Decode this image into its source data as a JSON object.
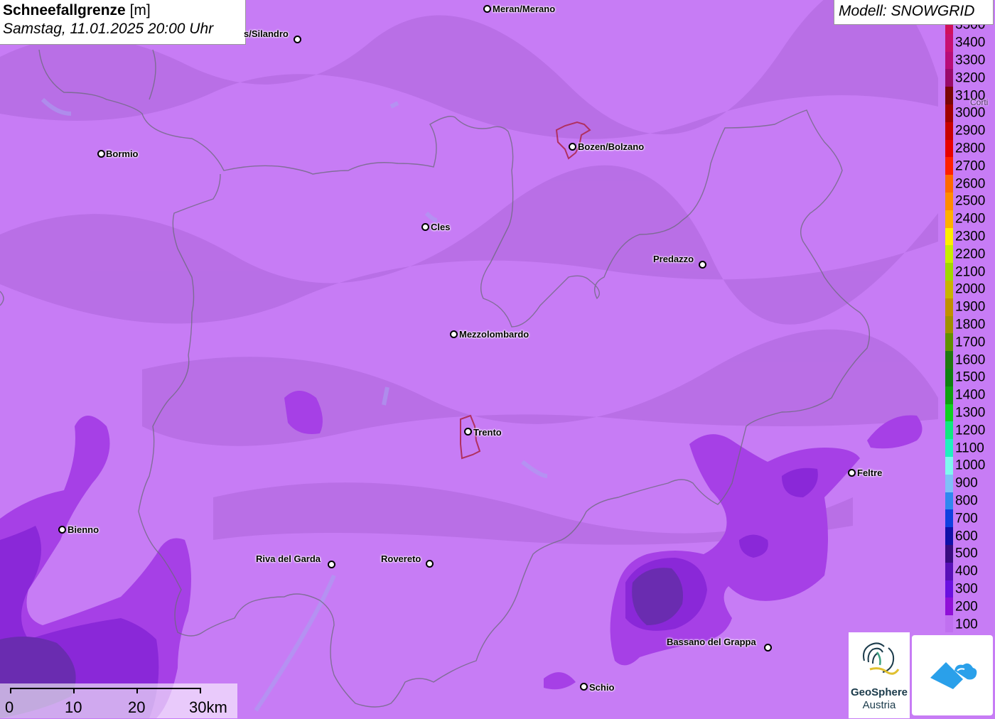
{
  "header": {
    "title_bold": "Schneefallgrenze",
    "title_unit": " [m]",
    "date": "Samstag, 11.01.2025 20:00 Uhr"
  },
  "model": {
    "label": "Modell: SNOWGRID"
  },
  "legend": {
    "items": [
      {
        "label": "3500",
        "color": "#d0105a"
      },
      {
        "label": "3400",
        "color": "#c81070"
      },
      {
        "label": "3300",
        "color": "#b80c78"
      },
      {
        "label": "3200",
        "color": "#9a0a6a"
      },
      {
        "label": "3100",
        "color": "#7a0505"
      },
      {
        "label": "3000",
        "color": "#a00000"
      },
      {
        "label": "2900",
        "color": "#c80000"
      },
      {
        "label": "2800",
        "color": "#e80000"
      },
      {
        "label": "2700",
        "color": "#ff2000"
      },
      {
        "label": "2600",
        "color": "#ff6a00"
      },
      {
        "label": "2500",
        "color": "#ff8c00"
      },
      {
        "label": "2400",
        "color": "#ffb000"
      },
      {
        "label": "2300",
        "color": "#ffee00"
      },
      {
        "label": "2200",
        "color": "#c8ee00"
      },
      {
        "label": "2100",
        "color": "#a0d800"
      },
      {
        "label": "2000",
        "color": "#c8b400"
      },
      {
        "label": "1900",
        "color": "#c09000"
      },
      {
        "label": "1800",
        "color": "#a09000"
      },
      {
        "label": "1700",
        "color": "#609000"
      },
      {
        "label": "1600",
        "color": "#207810"
      },
      {
        "label": "1500",
        "color": "#108010"
      },
      {
        "label": "1400",
        "color": "#10a010"
      },
      {
        "label": "1300",
        "color": "#10d020"
      },
      {
        "label": "1200",
        "color": "#10e880"
      },
      {
        "label": "1100",
        "color": "#20f0c0"
      },
      {
        "label": "1000",
        "color": "#80f8f0"
      },
      {
        "label": "900",
        "color": "#80c0f8"
      },
      {
        "label": "800",
        "color": "#3088f0"
      },
      {
        "label": "700",
        "color": "#1040e0"
      },
      {
        "label": "600",
        "color": "#1010a8"
      },
      {
        "label": "500",
        "color": "#380c80"
      },
      {
        "label": "400",
        "color": "#5810b8"
      },
      {
        "label": "300",
        "color": "#6a10e0"
      },
      {
        "label": "200",
        "color": "#9010d8"
      },
      {
        "label": "100",
        "color": "#c070f0"
      }
    ]
  },
  "cities": [
    {
      "name": "Meran/Merano"
    },
    {
      "name": "s/Silandro"
    },
    {
      "name": "Bormio"
    },
    {
      "name": "Bozen/Bolzano"
    },
    {
      "name": "Cles"
    },
    {
      "name": "Predazzo"
    },
    {
      "name": "Mezzolombardo"
    },
    {
      "name": "Trento"
    },
    {
      "name": "Feltre"
    },
    {
      "name": "Bienno"
    },
    {
      "name": "Riva del Garda"
    },
    {
      "name": "Rovereto"
    },
    {
      "name": "Bassano del Grappa"
    },
    {
      "name": "Schio"
    },
    {
      "name": "Corti"
    }
  ],
  "scale": {
    "labels": [
      "0",
      "10",
      "20",
      "30km"
    ]
  },
  "logos": {
    "geosphere_line1": "GeoSphere",
    "geosphere_line2": "Austria"
  },
  "colors": {
    "base_snowline": "#c77cf5",
    "level_200": "#a640e6",
    "level_300": "#8a28d8",
    "level_400": "#6a2cb0"
  }
}
